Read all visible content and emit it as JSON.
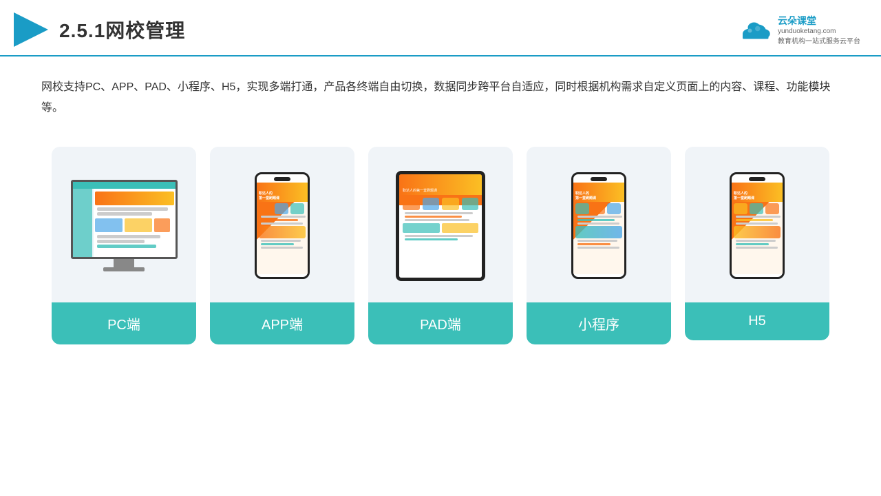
{
  "header": {
    "section_number": "2.5.1",
    "title": "网校管理",
    "logo_name": "云朵课堂",
    "logo_url": "yunduoketang.com",
    "logo_tagline": "教育机构一站式服务云平台"
  },
  "description": "网校支持PC、APP、PAD、小程序、H5，实现多端打通，产品各终端自由切换，数据同步跨平台自适应，同时根据机构需求自定义页面上的内容、课程、功能模块等。",
  "cards": [
    {
      "id": "pc",
      "label": "PC端"
    },
    {
      "id": "app",
      "label": "APP端"
    },
    {
      "id": "pad",
      "label": "PAD端"
    },
    {
      "id": "miniprogram",
      "label": "小程序"
    },
    {
      "id": "h5",
      "label": "H5"
    }
  ],
  "accent_color": "#3bbfb8",
  "header_color": "#1a9cc6"
}
